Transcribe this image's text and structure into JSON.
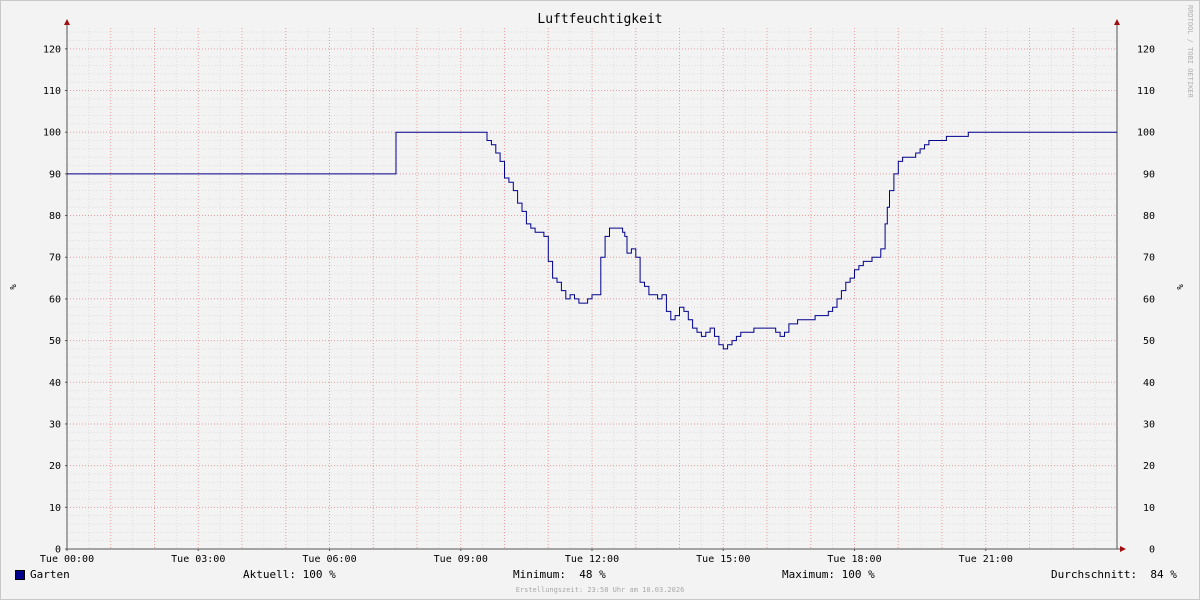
{
  "chart_data": {
    "type": "line",
    "title": "Luftfeuchtigkeit",
    "ylabel": "%",
    "ylim": [
      0,
      125
    ],
    "yticks": [
      0,
      10,
      20,
      30,
      40,
      50,
      60,
      70,
      80,
      90,
      100,
      110,
      120
    ],
    "xlim": [
      0,
      24
    ],
    "xticks": [
      {
        "t": 0,
        "label": "Tue 00:00"
      },
      {
        "t": 3,
        "label": "Tue 03:00"
      },
      {
        "t": 6,
        "label": "Tue 06:00"
      },
      {
        "t": 9,
        "label": "Tue 09:00"
      },
      {
        "t": 12,
        "label": "Tue 12:00"
      },
      {
        "t": 15,
        "label": "Tue 15:00"
      },
      {
        "t": 18,
        "label": "Tue 18:00"
      },
      {
        "t": 21,
        "label": "Tue 21:00"
      }
    ],
    "grid": true,
    "series": [
      {
        "name": "Garten",
        "color": "#00008c",
        "points": [
          [
            0,
            90
          ],
          [
            7.5,
            90
          ],
          [
            7.52,
            100
          ],
          [
            9.5,
            100
          ],
          [
            9.6,
            98
          ],
          [
            9.7,
            97
          ],
          [
            9.8,
            95
          ],
          [
            9.9,
            93
          ],
          [
            10.0,
            89
          ],
          [
            10.1,
            88
          ],
          [
            10.2,
            86
          ],
          [
            10.3,
            83
          ],
          [
            10.4,
            81
          ],
          [
            10.5,
            78
          ],
          [
            10.6,
            77
          ],
          [
            10.7,
            76
          ],
          [
            10.8,
            76
          ],
          [
            10.9,
            75
          ],
          [
            11.0,
            69
          ],
          [
            11.1,
            65
          ],
          [
            11.2,
            64
          ],
          [
            11.3,
            62
          ],
          [
            11.4,
            60
          ],
          [
            11.5,
            61
          ],
          [
            11.6,
            60
          ],
          [
            11.7,
            59
          ],
          [
            11.8,
            59
          ],
          [
            11.9,
            60
          ],
          [
            12.0,
            61
          ],
          [
            12.1,
            61
          ],
          [
            12.2,
            70
          ],
          [
            12.3,
            75
          ],
          [
            12.4,
            77
          ],
          [
            12.5,
            77
          ],
          [
            12.6,
            77
          ],
          [
            12.7,
            76
          ],
          [
            12.75,
            75
          ],
          [
            12.8,
            71
          ],
          [
            12.9,
            72
          ],
          [
            13.0,
            70
          ],
          [
            13.1,
            64
          ],
          [
            13.2,
            63
          ],
          [
            13.3,
            61
          ],
          [
            13.4,
            61
          ],
          [
            13.5,
            60
          ],
          [
            13.6,
            61
          ],
          [
            13.7,
            57
          ],
          [
            13.8,
            55
          ],
          [
            13.9,
            56
          ],
          [
            14.0,
            58
          ],
          [
            14.1,
            57
          ],
          [
            14.2,
            55
          ],
          [
            14.3,
            53
          ],
          [
            14.4,
            52
          ],
          [
            14.5,
            51
          ],
          [
            14.6,
            52
          ],
          [
            14.7,
            53
          ],
          [
            14.8,
            51
          ],
          [
            14.9,
            49
          ],
          [
            15.0,
            48
          ],
          [
            15.1,
            49
          ],
          [
            15.2,
            50
          ],
          [
            15.3,
            51
          ],
          [
            15.4,
            52
          ],
          [
            15.5,
            52
          ],
          [
            15.7,
            53
          ],
          [
            16.0,
            53
          ],
          [
            16.2,
            52
          ],
          [
            16.3,
            51
          ],
          [
            16.4,
            52
          ],
          [
            16.5,
            54
          ],
          [
            16.6,
            54
          ],
          [
            16.7,
            55
          ],
          [
            17.0,
            55
          ],
          [
            17.1,
            56
          ],
          [
            17.4,
            57
          ],
          [
            17.5,
            58
          ],
          [
            17.6,
            60
          ],
          [
            17.7,
            62
          ],
          [
            17.8,
            64
          ],
          [
            17.9,
            65
          ],
          [
            18.0,
            67
          ],
          [
            18.1,
            68
          ],
          [
            18.2,
            69
          ],
          [
            18.4,
            70
          ],
          [
            18.6,
            72
          ],
          [
            18.7,
            78
          ],
          [
            18.75,
            82
          ],
          [
            18.8,
            86
          ],
          [
            18.9,
            90
          ],
          [
            19.0,
            93
          ],
          [
            19.1,
            94
          ],
          [
            19.3,
            94
          ],
          [
            19.4,
            95
          ],
          [
            19.5,
            96
          ],
          [
            19.6,
            97
          ],
          [
            19.7,
            98
          ],
          [
            19.9,
            98
          ],
          [
            20.0,
            98
          ],
          [
            20.1,
            99
          ],
          [
            20.5,
            99
          ],
          [
            20.6,
            100
          ],
          [
            24,
            100
          ]
        ]
      }
    ],
    "stats": {
      "aktuell_label": "Aktuell:",
      "aktuell": "100 %",
      "minimum_label": "Minimum:",
      "minimum": " 48 %",
      "maximum_label": "Maximum:",
      "maximum": "100 %",
      "durchschnitt_label": "Durchschnitt:",
      "durchschnitt": " 84 %"
    }
  },
  "watermark": "RRDTOOL / TOBI OETIKER",
  "footer": "Erstellungszeit: 23:58 Uhr am 10.03.2026"
}
